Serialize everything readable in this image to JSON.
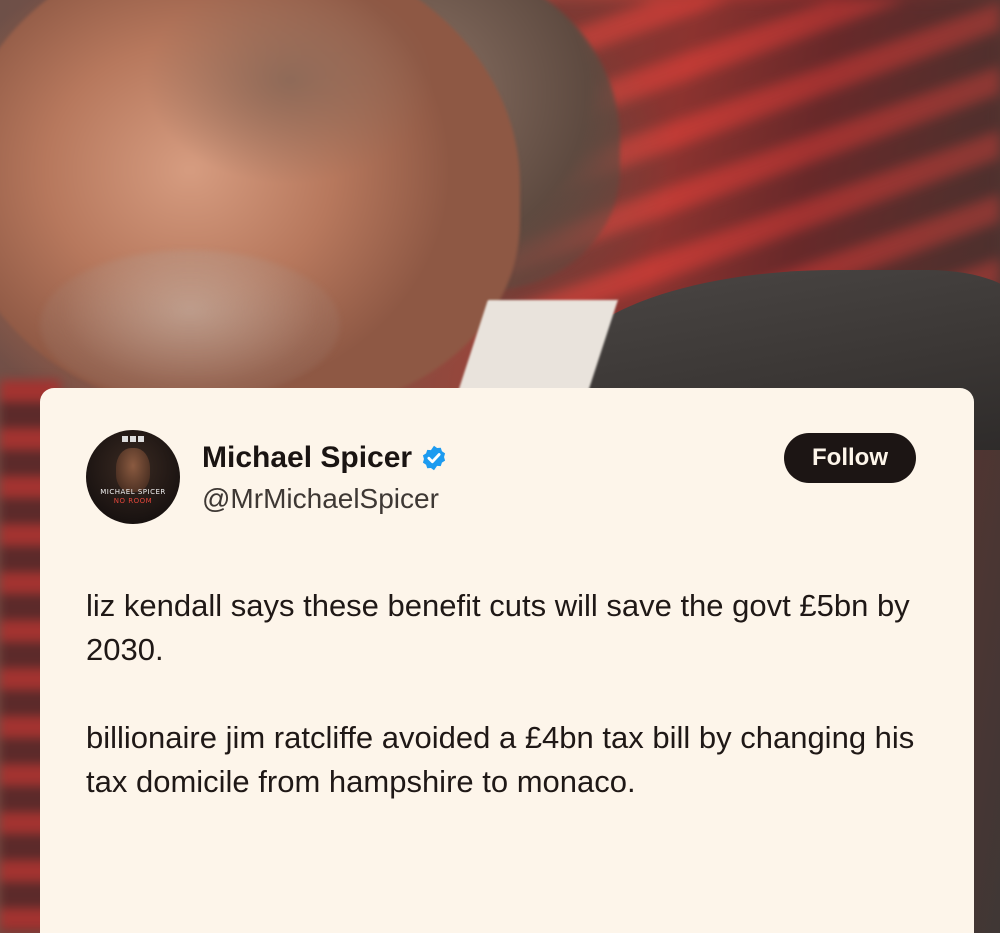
{
  "tweet": {
    "display_name": "Michael Spicer",
    "handle": "@MrMichaelSpicer",
    "follow_label": "Follow",
    "avatar": {
      "badge": "BBC",
      "title": "MICHAEL SPICER",
      "subtitle": "NO ROOM"
    },
    "paragraphs": [
      "liz kendall says these benefit cuts will save the govt £5bn by 2030.",
      "billionaire jim ratcliffe avoided a £4bn tax bill by changing his tax domicile from hampshire to monaco."
    ]
  },
  "colors": {
    "card_background": "#fdf5ea",
    "follow_button": "#1c1514",
    "verified_badge": "#1d9bf0"
  },
  "icons": {
    "verified": "verified-badge-icon"
  }
}
